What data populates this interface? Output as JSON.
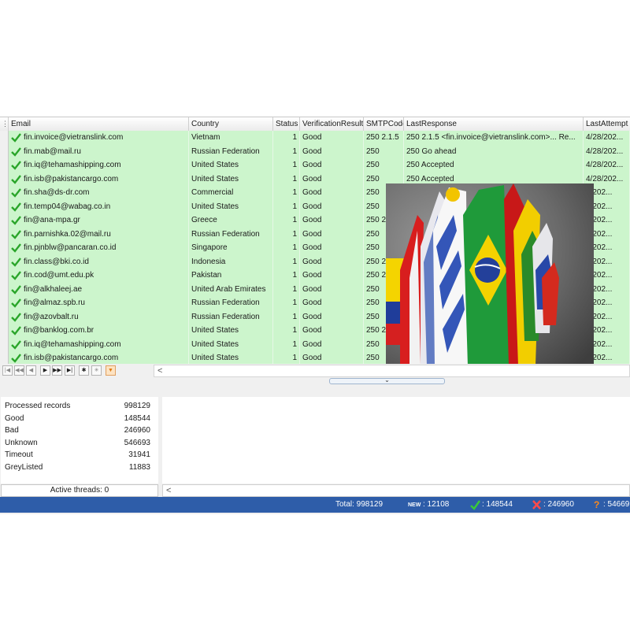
{
  "grid": {
    "columns": [
      "Email",
      "Country",
      "Status",
      "VerificationResult",
      "SMTPCode",
      "LastResponse",
      "LastAttempt"
    ],
    "rows": [
      {
        "email": "fin.invoice@vietranslink.com",
        "country": "Vietnam",
        "status": "1",
        "result": "Good",
        "smtp": "250 2.1.5",
        "response": "250 2.1.5 <fin.invoice@vietranslink.com>... Re...",
        "attempt": "4/28/202..."
      },
      {
        "email": "fin.mab@mail.ru",
        "country": "Russian Federation",
        "status": "1",
        "result": "Good",
        "smtp": "250",
        "response": "250 Go ahead",
        "attempt": "4/28/202..."
      },
      {
        "email": "fin.iq@tehamashipping.com",
        "country": "United States",
        "status": "1",
        "result": "Good",
        "smtp": "250",
        "response": "250 Accepted",
        "attempt": "4/28/202..."
      },
      {
        "email": "fin.isb@pakistancargo.com",
        "country": "United States",
        "status": "1",
        "result": "Good",
        "smtp": "250",
        "response": "250 Accepted",
        "attempt": "4/28/202..."
      },
      {
        "email": "fin.sha@ds-dr.com",
        "country": "Commercial",
        "status": "1",
        "result": "Good",
        "smtp": "250",
        "response": "",
        "attempt": "8/202..."
      },
      {
        "email": "fin.temp04@wabag.co.in",
        "country": "United States",
        "status": "1",
        "result": "Good",
        "smtp": "250",
        "response": "",
        "attempt": "8/202..."
      },
      {
        "email": "fin@ana-mpa.gr",
        "country": "Greece",
        "status": "1",
        "result": "Good",
        "smtp": "250 2",
        "response": "",
        "attempt": "8/202..."
      },
      {
        "email": "fin.parnishka.02@mail.ru",
        "country": "Russian Federation",
        "status": "1",
        "result": "Good",
        "smtp": "250",
        "response": "",
        "attempt": "8/202..."
      },
      {
        "email": "fin.pjnblw@pancaran.co.id",
        "country": "Singapore",
        "status": "1",
        "result": "Good",
        "smtp": "250",
        "response": "",
        "attempt": "8/202..."
      },
      {
        "email": "fin.class@bki.co.id",
        "country": "Indonesia",
        "status": "1",
        "result": "Good",
        "smtp": "250 2",
        "response": "",
        "attempt": "8/202..."
      },
      {
        "email": "fin.cod@umt.edu.pk",
        "country": "Pakistan",
        "status": "1",
        "result": "Good",
        "smtp": "250 2",
        "response": "",
        "attempt": "8/202..."
      },
      {
        "email": "fin@alkhaleej.ae",
        "country": "United Arab Emirates",
        "status": "1",
        "result": "Good",
        "smtp": "250",
        "response": "",
        "attempt": "8/202..."
      },
      {
        "email": "fin@almaz.spb.ru",
        "country": "Russian Federation",
        "status": "1",
        "result": "Good",
        "smtp": "250",
        "response": "",
        "attempt": "8/202..."
      },
      {
        "email": "fin@azovbalt.ru",
        "country": "Russian Federation",
        "status": "1",
        "result": "Good",
        "smtp": "250",
        "response": "",
        "attempt": "8/202..."
      },
      {
        "email": "fin@banklog.com.br",
        "country": "United States",
        "status": "1",
        "result": "Good",
        "smtp": "250 2",
        "response": "",
        "attempt": "8/202..."
      },
      {
        "email": "fin.iq@tehamashipping.com",
        "country": "United States",
        "status": "1",
        "result": "Good",
        "smtp": "250",
        "response": "",
        "attempt": "8/202..."
      },
      {
        "email": "fin.isb@pakistancargo.com",
        "country": "United States",
        "status": "1",
        "result": "Good",
        "smtp": "250",
        "response": "",
        "attempt": "8/202..."
      }
    ]
  },
  "navigator": {
    "buttons": [
      "first",
      "prev-page",
      "prev",
      "next",
      "next-page",
      "last",
      "insert",
      "delete",
      "filter"
    ],
    "scroll_left": "<"
  },
  "splitter_icon": "chevron-down",
  "stats": [
    {
      "label": "Processed records",
      "value": "998129"
    },
    {
      "label": "Good",
      "value": "148544"
    },
    {
      "label": "Bad",
      "value": "246960"
    },
    {
      "label": "Unknown",
      "value": "546693"
    },
    {
      "label": "Timeout",
      "value": "31941"
    },
    {
      "label": "GreyListed",
      "value": "11883"
    }
  ],
  "threads_label": "Active threads: 0",
  "log_scroll_left": "<",
  "statusbar": {
    "total": "Total: 998129",
    "new_tag": "NEW",
    "new_value": ": 12108",
    "good_value": ": 148544",
    "bad_value": ": 246960",
    "unknown_value": ": 54669"
  },
  "colors": {
    "row_good": "#ccf5cc",
    "statusbar": "#2e5da9",
    "check": "#2aa52a",
    "bad": "#e03030",
    "unknown": "#f07a10"
  }
}
